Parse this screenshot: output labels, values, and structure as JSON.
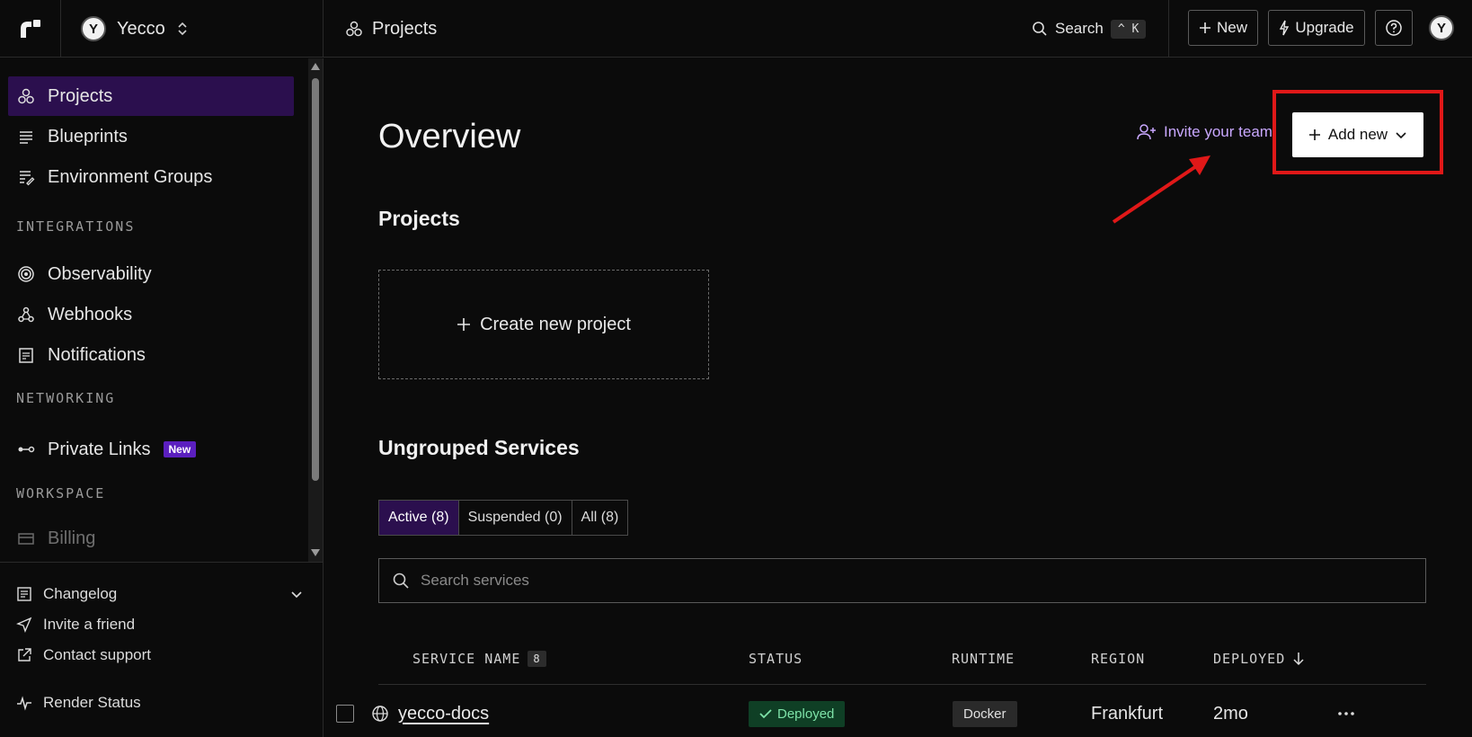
{
  "topbar": {
    "logo_icon": "render-logo-icon",
    "workspace": {
      "avatar_letter": "Y",
      "name": "Yecco"
    },
    "breadcrumb": "Projects",
    "search": {
      "label": "Search",
      "shortcut": "^ K"
    },
    "new_label": "New",
    "upgrade_label": "Upgrade",
    "user_avatar": "Y"
  },
  "sidebar": {
    "items": [
      {
        "label": "Projects",
        "icon": "projects-icon",
        "active": true
      },
      {
        "label": "Blueprints",
        "icon": "blueprints-icon"
      },
      {
        "label": "Environment Groups",
        "icon": "env-groups-icon"
      }
    ],
    "integrations_heading": "INTEGRATIONS",
    "integrations": [
      {
        "label": "Observability",
        "icon": "observability-icon"
      },
      {
        "label": "Webhooks",
        "icon": "webhooks-icon"
      },
      {
        "label": "Notifications",
        "icon": "notifications-icon"
      }
    ],
    "networking_heading": "NETWORKING",
    "networking": [
      {
        "label": "Private Links",
        "icon": "private-links-icon",
        "badge": "New"
      }
    ],
    "workspace_heading": "WORKSPACE",
    "workspace": [
      {
        "label": "Billing",
        "icon": "billing-icon"
      }
    ],
    "footer": [
      {
        "label": "Changelog",
        "icon": "changelog-icon"
      },
      {
        "label": "Invite a friend",
        "icon": "send-icon"
      },
      {
        "label": "Contact support",
        "icon": "external-link-icon"
      },
      {
        "label": "Render Status",
        "icon": "pulse-icon"
      }
    ]
  },
  "main": {
    "title": "Overview",
    "invite_label": "Invite your team",
    "add_new_label": "Add new",
    "projects_heading": "Projects",
    "create_project_label": "Create new project",
    "services_heading": "Ungrouped Services",
    "tabs": [
      "Active (8)",
      "Suspended (0)",
      "All (8)"
    ],
    "search_placeholder": "Search services",
    "table": {
      "headers": {
        "name": "SERVICE NAME",
        "count": "8",
        "status": "STATUS",
        "runtime": "RUNTIME",
        "region": "REGION",
        "deployed": "DEPLOYED"
      },
      "rows": [
        {
          "name": "yecco-docs",
          "status": "Deployed",
          "runtime": "Docker",
          "region": "Frankfurt",
          "deployed": "2mo"
        }
      ]
    }
  },
  "colors": {
    "accent_purple": "#2b0f4e",
    "highlight_red": "#e01818",
    "deployed_green": "#7ee2a8"
  }
}
